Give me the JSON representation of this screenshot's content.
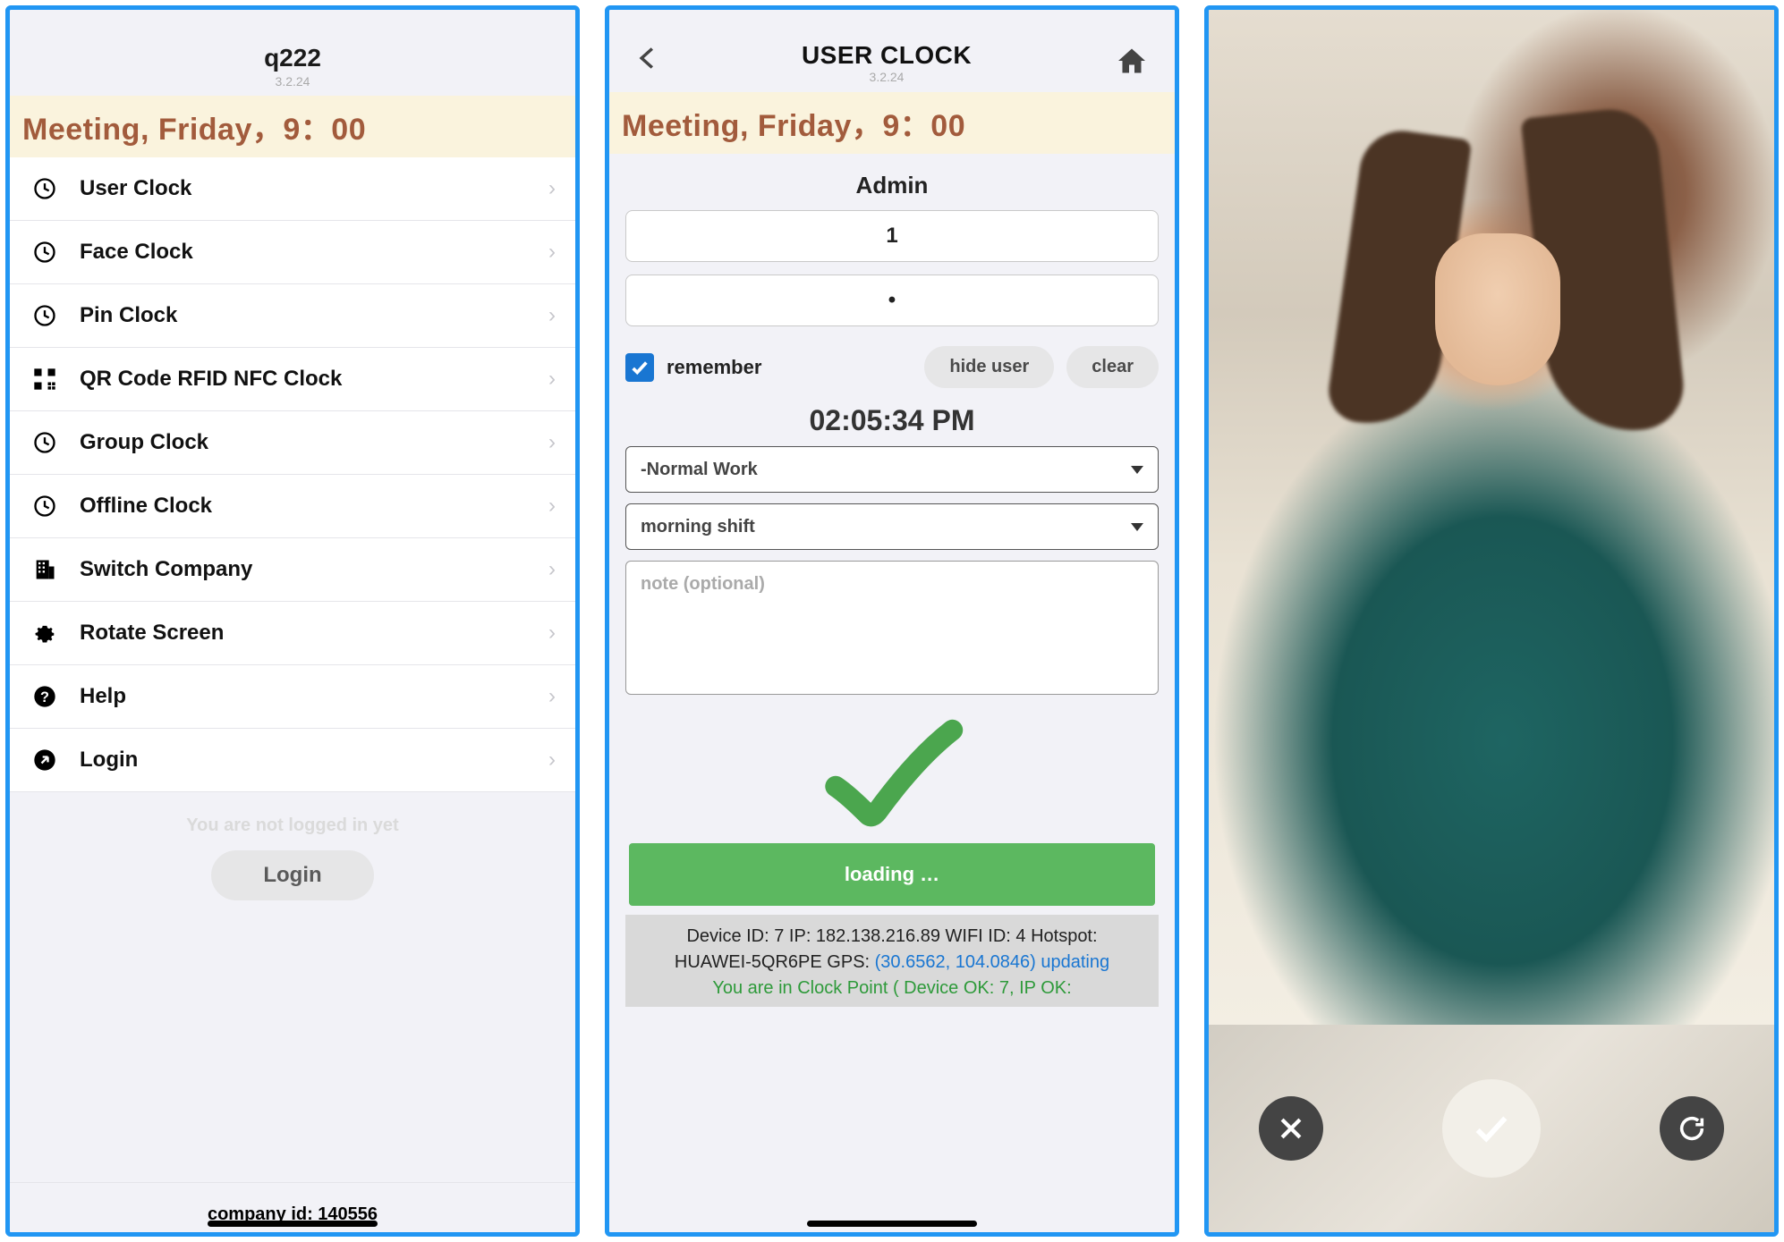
{
  "screen1": {
    "header_title": "q222",
    "version": "3.2.24",
    "banner": "Meeting, Friday，9：00",
    "menu": [
      {
        "label": "User Clock",
        "icon": "clock"
      },
      {
        "label": "Face Clock",
        "icon": "clock"
      },
      {
        "label": "Pin Clock",
        "icon": "clock"
      },
      {
        "label": "QR Code RFID NFC Clock",
        "icon": "qrcode"
      },
      {
        "label": "Group Clock",
        "icon": "clock"
      },
      {
        "label": "Offline Clock",
        "icon": "clock"
      },
      {
        "label": "Switch Company",
        "icon": "building"
      },
      {
        "label": "Rotate Screen",
        "icon": "gear"
      },
      {
        "label": "Help",
        "icon": "help"
      },
      {
        "label": "Login",
        "icon": "arrow-circle"
      }
    ],
    "not_logged_text": "You are not logged in yet",
    "login_button": "Login",
    "company_id_label": "company id: 140556"
  },
  "screen2": {
    "nav_title": "USER CLOCK",
    "version": "3.2.24",
    "banner": "Meeting, Friday，9：00",
    "role": "Admin",
    "user_value": "1",
    "password_value": "•",
    "remember_label": "remember",
    "hide_user_label": "hide user",
    "clear_label": "clear",
    "time": "02:05:34 PM",
    "work_type": "-Normal Work",
    "shift": "morning shift",
    "note_placeholder": "note (optional)",
    "loading_label": "loading …",
    "device": {
      "line1_a": "Device ID:  7   IP:  182.138.216.89   WIFI ID:  4   Hotspot:",
      "line2_a": "HUAWEI-5QR6PE    GPS: ",
      "gps": "(30.6562, 104.0846)",
      "updating": "  updating",
      "clockpoint": "You are in Clock Point ( Device OK: 7, IP OK:"
    }
  },
  "screen3": {
    "cancel": "cancel",
    "confirm": "confirm",
    "retry": "retry"
  }
}
